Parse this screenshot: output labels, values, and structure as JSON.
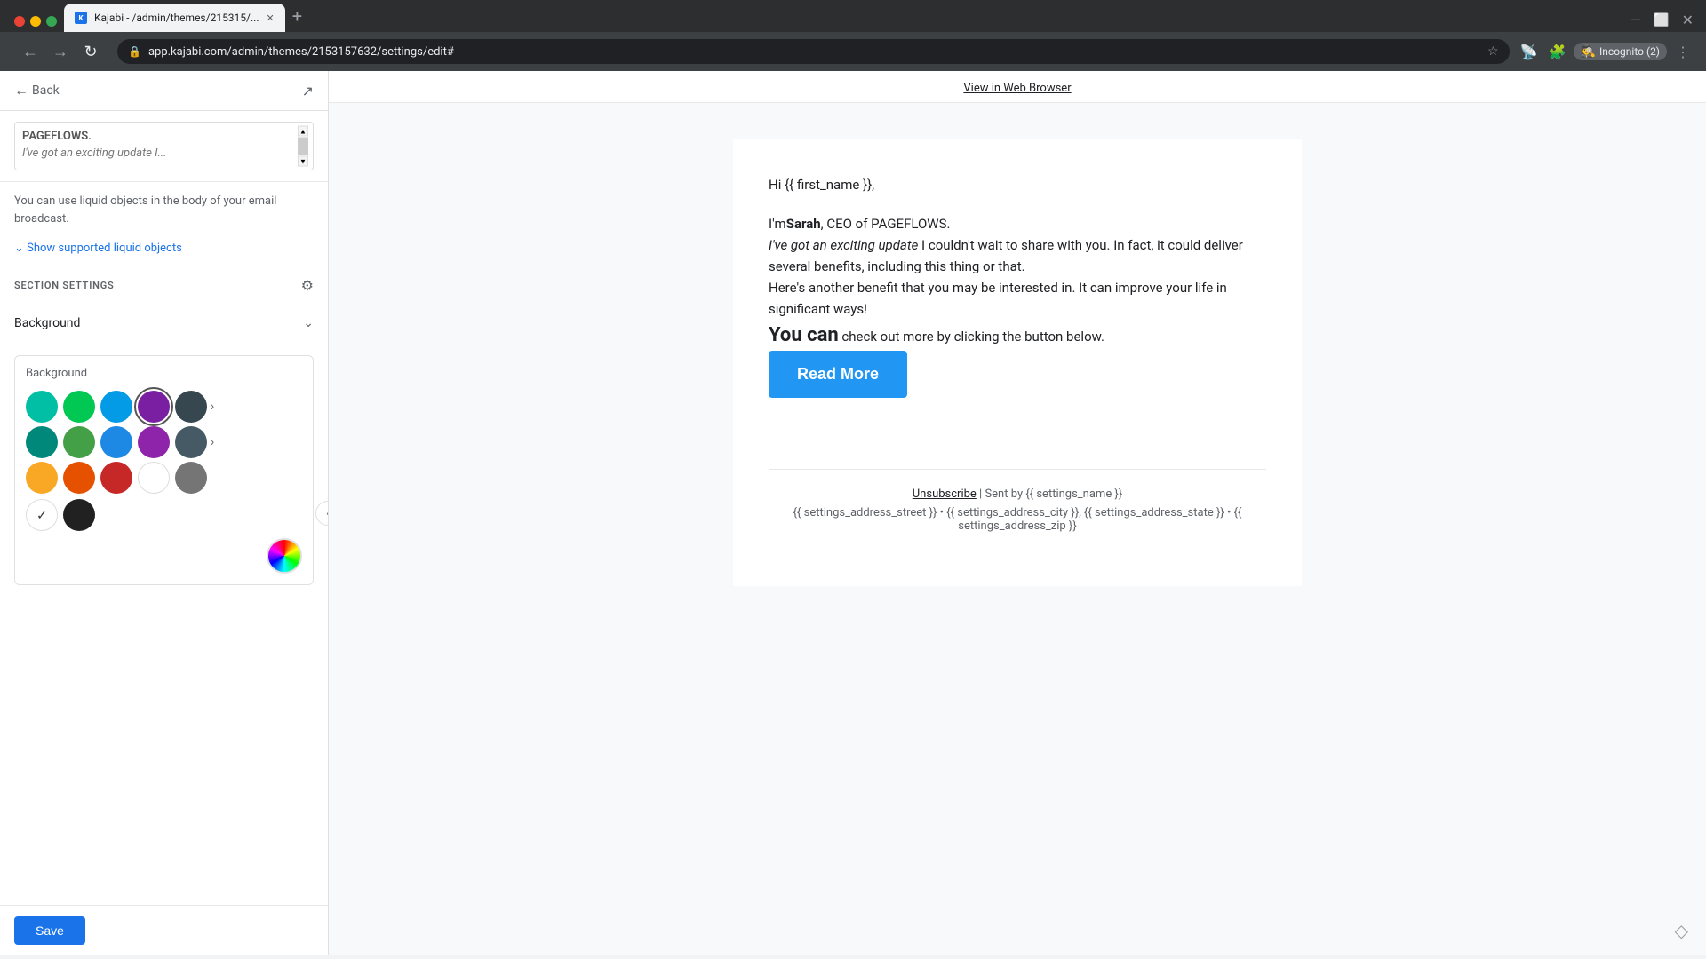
{
  "browser": {
    "url": "app.kajabi.com/admin/themes/2153157632/settings/edit#",
    "tab_title": "Kajabi - /admin/themes/215315/...",
    "incognito_label": "Incognito (2)"
  },
  "header": {
    "view_in_browser": "View in Web Browser",
    "back_label": "Back"
  },
  "sidebar": {
    "liquid_note": "You can use liquid objects in the body of your email broadcast.",
    "show_liquid_link": "Show supported liquid objects",
    "section_settings_title": "SECTION SETTINGS",
    "background_label": "Background",
    "color_picker_label": "Background",
    "save_button": "Save"
  },
  "email_subject_preview": "I've got an exciting update I...",
  "email_content": {
    "greeting": "Hi {{ first_name }},",
    "intro": "I'm",
    "bold_name": "Sarah",
    "intro_rest": ", CEO of PAGEFLOWS.",
    "italic_part": "I've got an exciting update",
    "body1_rest": " I couldn't wait to share with you. In fact, it could deliver several benefits, including this thing or that.",
    "body2": "Here's another benefit that you may be interested in. It can improve your life in significant ways!",
    "you_can_bold": "You can",
    "body3_rest": " check out more by clicking the button below.",
    "read_more_button": "Read More",
    "footer_unsubscribe": "Unsubscribe",
    "footer_sent": "| Sent by {{ settings_name }}",
    "footer_address": "{{ settings_address_street }} • {{ settings_address_city }}, {{ settings_address_state }} • {{ settings_address_zip }}"
  },
  "colors": {
    "row1": [
      "#00bfa5",
      "#00c853",
      "#039be5",
      "#7b1fa2",
      "#37474f"
    ],
    "row2": [
      "#00897b",
      "#43a047",
      "#1e88e5",
      "#8e24aa",
      "#455a64"
    ],
    "row3": [
      "#f9a825",
      "#e65100",
      "#c62828",
      "#ffffff",
      "#757575"
    ],
    "row4_check": "white",
    "row4_black": "#212121",
    "selected_index": 3,
    "selected_row": 0
  }
}
